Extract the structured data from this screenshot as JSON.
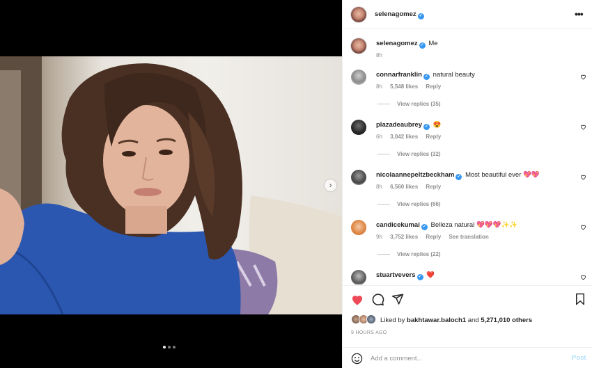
{
  "post": {
    "username": "selenagomez",
    "verified_mark": "✓",
    "more_icon": "•••",
    "caption": "Me",
    "caption_time": "8h",
    "next_icon": "›",
    "slides_count": 3,
    "active_slide": 1
  },
  "comments": [
    {
      "username": "connarfranklin",
      "text": "natural beauty",
      "time": "8h",
      "likes": "5,548 likes",
      "reply": "Reply",
      "translate": "",
      "view_replies": "View replies (35)"
    },
    {
      "username": "plazadeaubrey",
      "text": "😍",
      "time": "6h",
      "likes": "3,042 likes",
      "reply": "Reply",
      "translate": "",
      "view_replies": "View replies (32)"
    },
    {
      "username": "nicolaannepeltzbeckham",
      "text": "Most beautiful ever 💖💖",
      "time": "8h",
      "likes": "6,560 likes",
      "reply": "Reply",
      "translate": "",
      "view_replies": "View replies (66)"
    },
    {
      "username": "candicekumai",
      "text": "Belleza natural 💖💖💖✨✨",
      "time": "9h",
      "likes": "3,752 likes",
      "reply": "Reply",
      "translate": "See translation",
      "view_replies": "View replies (22)"
    },
    {
      "username": "stuartvevers",
      "text": "❤️",
      "time": "",
      "likes": "",
      "reply": "",
      "translate": "",
      "view_replies": ""
    }
  ],
  "likes": {
    "prefix": "Liked by",
    "user": "bakhtawar.baloch1",
    "middle": "and",
    "others": "5,271,010 others"
  },
  "time_ago": "9 HOURS AGO",
  "add_comment": {
    "placeholder": "Add a comment...",
    "post_label": "Post"
  },
  "colors": {
    "like_red": "#ed4956",
    "verified_blue": "#3897f0",
    "post_disabled": "#b2dffc"
  },
  "icons": [
    "more-icon",
    "verified-icon",
    "heart-icon",
    "comment-icon",
    "share-icon",
    "bookmark-icon",
    "emoji-icon",
    "next-arrow-icon"
  ]
}
